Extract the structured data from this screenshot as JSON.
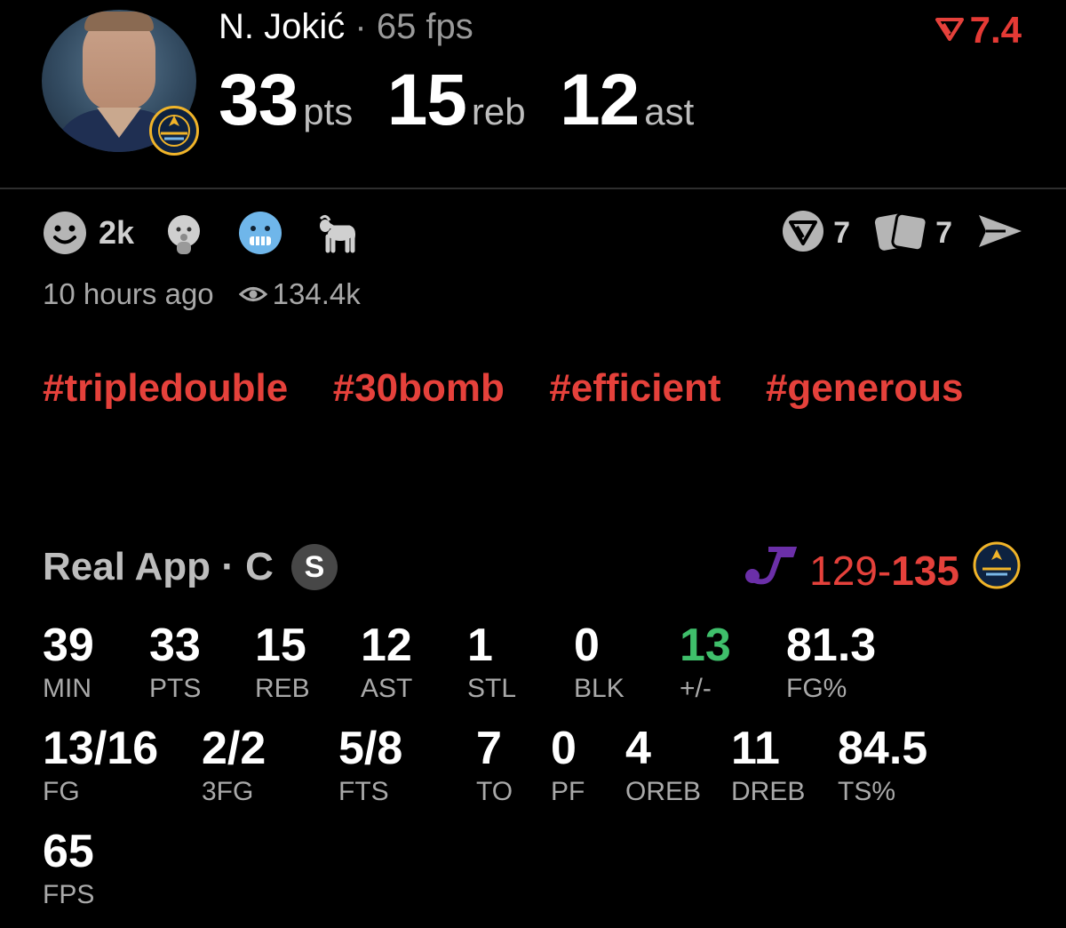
{
  "header": {
    "player_name": "N. Jokić",
    "separator": "·",
    "fps_label": "65 fps",
    "rating": "7.4",
    "stats": [
      {
        "value": "33",
        "unit": "pts"
      },
      {
        "value": "15",
        "unit": "reb"
      },
      {
        "value": "12",
        "unit": "ast"
      }
    ]
  },
  "reactions": {
    "count": "2k",
    "icons": [
      "smiley-icon",
      "baby-icon",
      "cold-face-icon",
      "goat-icon"
    ],
    "poll_count": "7",
    "cards_count": "7"
  },
  "meta": {
    "time_ago": "10 hours ago",
    "views": "134.4k"
  },
  "hashtags": [
    "#tripledouble",
    "#30bomb",
    "#efficient",
    "#generous"
  ],
  "boxscore": {
    "source": "Real App · C",
    "badge": "S",
    "score_away": "129",
    "score_sep": "-",
    "score_home": "135",
    "row1": [
      {
        "value": "39",
        "label": "MIN"
      },
      {
        "value": "33",
        "label": "PTS"
      },
      {
        "value": "15",
        "label": "REB"
      },
      {
        "value": "12",
        "label": "AST"
      },
      {
        "value": "1",
        "label": "STL"
      },
      {
        "value": "0",
        "label": "BLK"
      },
      {
        "value": "13",
        "label": "+/-"
      },
      {
        "value": "81.3",
        "label": "FG%"
      }
    ],
    "row2": [
      {
        "value": "13/16",
        "label": "FG"
      },
      {
        "value": "2/2",
        "label": "3FG"
      },
      {
        "value": "5/8",
        "label": "FTS"
      },
      {
        "value": "7",
        "label": "TO"
      },
      {
        "value": "0",
        "label": "PF"
      },
      {
        "value": "4",
        "label": "OREB"
      },
      {
        "value": "11",
        "label": "DREB"
      },
      {
        "value": "84.5",
        "label": "TS%"
      }
    ],
    "row3": [
      {
        "value": "65",
        "label": "FPS"
      }
    ]
  },
  "colors": {
    "accent_red": "#e5413b",
    "positive_green": "#3fbf6b",
    "jazz_purple": "#6b2fa8",
    "nuggets_gold": "#f0b429"
  }
}
